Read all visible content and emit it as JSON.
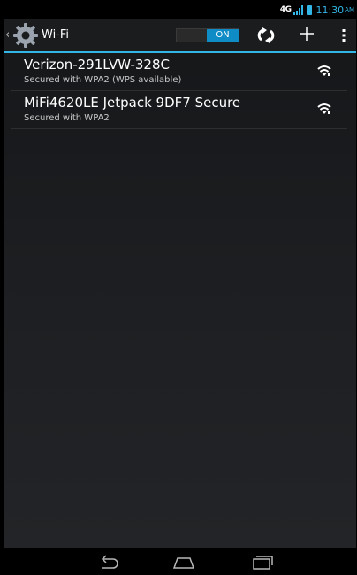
{
  "status_bar": {
    "network": "4G",
    "time": "11:30",
    "ampm": "AM"
  },
  "action_bar": {
    "title": "Wi-Fi",
    "toggle_state": "ON"
  },
  "networks": [
    {
      "name": "Verizon-291LVW-328C",
      "security": "Secured with WPA2 (WPS available)"
    },
    {
      "name": "MiFi4620LE Jetpack 9DF7 Secure",
      "security": "Secured with WPA2"
    }
  ],
  "colors": {
    "accent": "#33b5e5",
    "toggle_on": "#0f8bc6"
  }
}
